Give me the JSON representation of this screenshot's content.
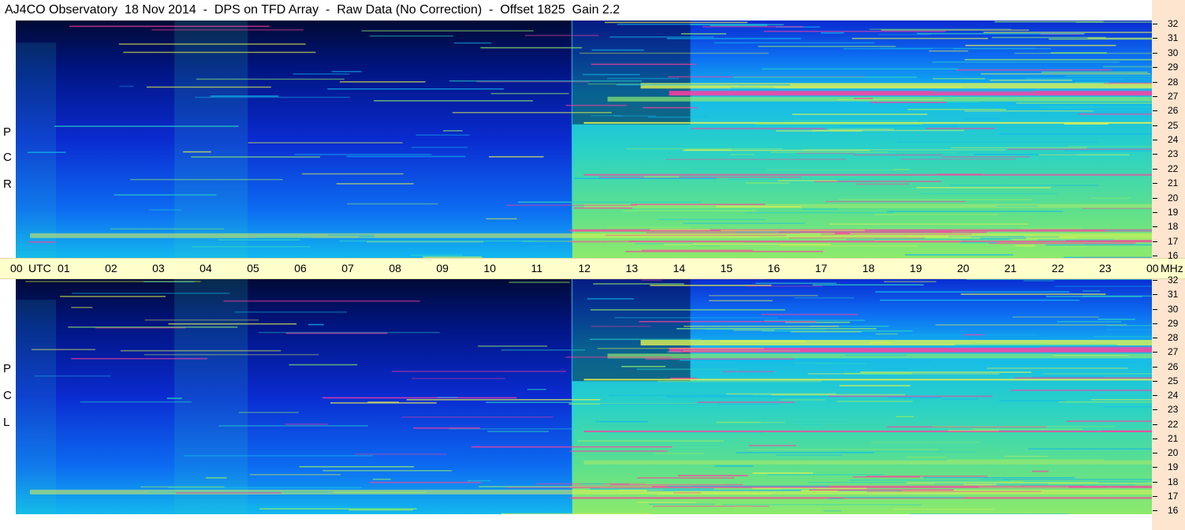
{
  "title": "AJ4CO Observatory  18 Nov 2014  -  DPS on TFD Array  -  Raw Data (No Correction)  -  Offset 1825  Gain 2.2",
  "time_axis": {
    "labels": [
      "00",
      "01",
      "02",
      "03",
      "04",
      "05",
      "06",
      "07",
      "08",
      "09",
      "10",
      "11",
      "12",
      "13",
      "14",
      "15",
      "16",
      "17",
      "18",
      "19",
      "20",
      "21",
      "22",
      "23",
      "00"
    ],
    "utc_label": "UTC",
    "mhz_label": "MHz"
  },
  "freq_axis": {
    "labels": [
      "32",
      "31",
      "30",
      "29",
      "28",
      "27",
      "26",
      "25",
      "24",
      "23",
      "22",
      "21",
      "20",
      "19",
      "18",
      "17",
      "16"
    ],
    "range": [
      16,
      32
    ],
    "unit": "MHz"
  },
  "panels": [
    {
      "id": "rcp",
      "label_chars": [
        "P",
        "C",
        "R"
      ]
    },
    {
      "id": "lcp",
      "label_chars": [
        "P",
        "C",
        "L"
      ]
    }
  ],
  "colors": {
    "night_dark": "#000a33",
    "deep_blue": "#0a2bd0",
    "blue": "#0d6cf2",
    "cyan": "#12b8ee",
    "teal": "#2ad2c6",
    "green": "#8cea6c",
    "yellow": "#e2f250",
    "magenta": "#ff3fa0",
    "band_bg": "#ffffcc",
    "axis_bg": "#fde5cf"
  },
  "chart_data": {
    "type": "heatmap",
    "title": "AJ4CO Observatory  18 Nov 2014  -  DPS on TFD Array  -  Raw Data (No Correction)  -  Offset 1825  Gain 2.2",
    "xlabel": "UTC",
    "ylabel": "MHz",
    "x_range_utc_hours": [
      0,
      24
    ],
    "y_range_mhz": [
      16,
      32
    ],
    "panels": [
      "RCP",
      "LCP"
    ],
    "strong_emission_mhz": [
      27.1,
      25.1,
      21.6,
      17.8,
      17.1
    ],
    "daytime_start_utc": 11.75,
    "daytime_end_utc": 24
  }
}
